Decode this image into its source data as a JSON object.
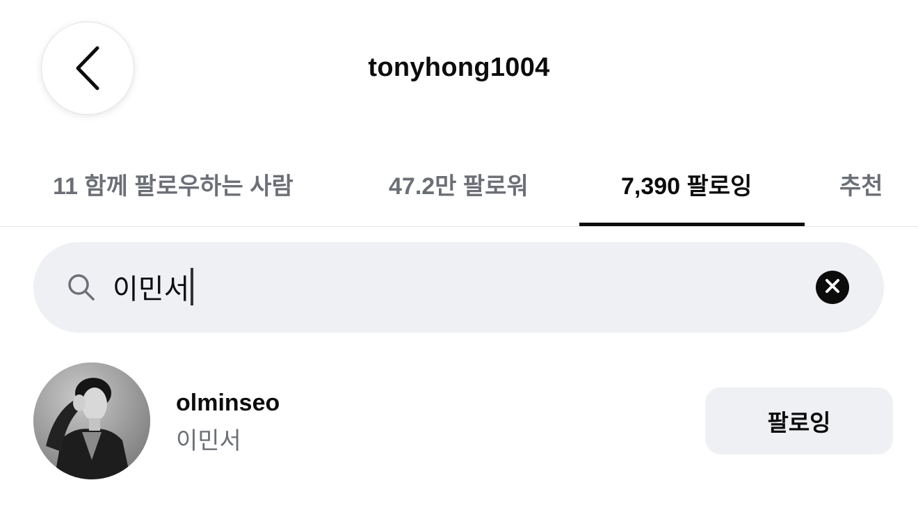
{
  "header": {
    "title": "tonyhong1004",
    "back_icon": "chevron-left-icon"
  },
  "tabs": [
    {
      "label": "11 함께 팔로우하는 사람",
      "active": false
    },
    {
      "label": "47.2만 팔로워",
      "active": false
    },
    {
      "label": "7,390 팔로잉",
      "active": true
    },
    {
      "label": "추천",
      "active": false
    }
  ],
  "search": {
    "value": "이민서",
    "search_icon": "search-icon",
    "clear_icon": "close-circle-icon"
  },
  "results": [
    {
      "username": "olminseo",
      "full_name": "이민서",
      "button_label": "팔로잉"
    }
  ],
  "colors": {
    "text_primary": "#0c0c0d",
    "text_secondary": "#6c6f76",
    "surface_gray": "#eff0f3"
  }
}
